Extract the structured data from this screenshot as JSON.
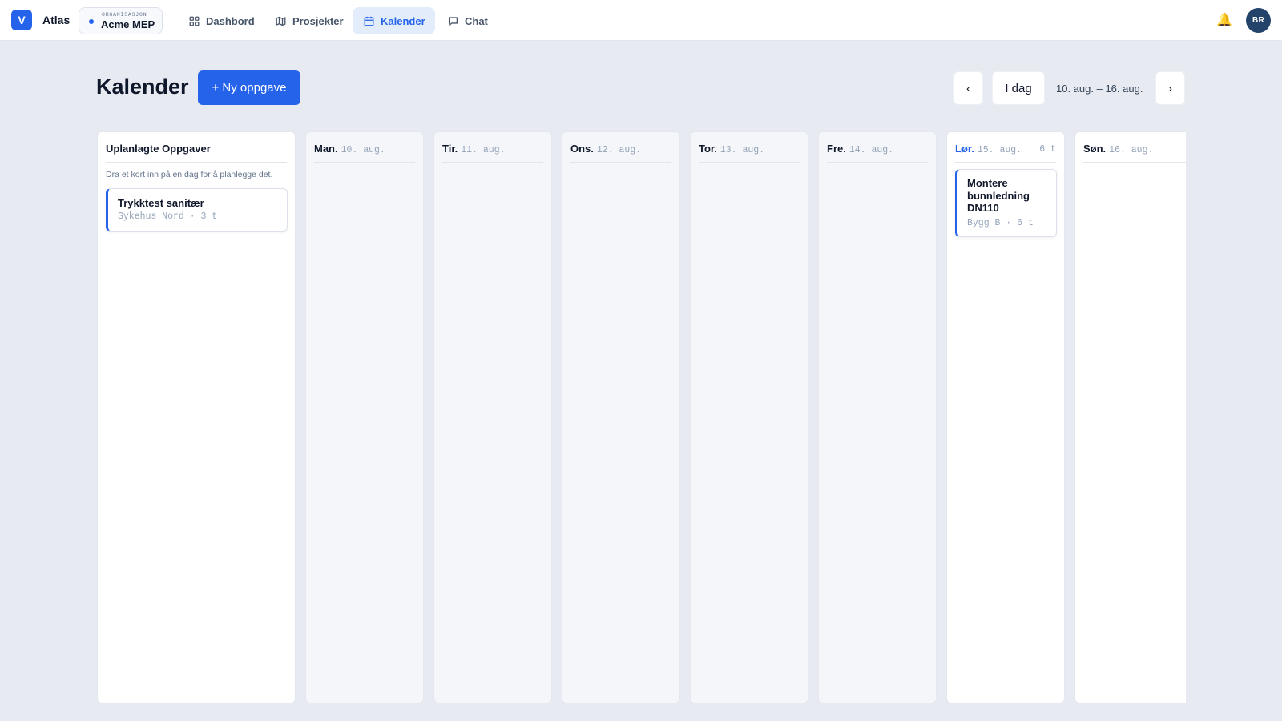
{
  "app": {
    "logo_letter": "V",
    "name": "Atlas"
  },
  "org": {
    "caption": "ORGANISASJON",
    "name": "Acme MEP"
  },
  "nav": {
    "items": [
      {
        "label": "Dashbord",
        "icon": "dashboard-icon"
      },
      {
        "label": "Prosjekter",
        "icon": "map-icon"
      },
      {
        "label": "Kalender",
        "icon": "calendar-icon",
        "active": true
      },
      {
        "label": "Chat",
        "icon": "chat-icon"
      }
    ]
  },
  "user": {
    "initials": "BR"
  },
  "page": {
    "title": "Kalender",
    "new_task_label": "+ Ny oppgave",
    "prev_label": "‹",
    "today_label": "I dag",
    "next_label": "›",
    "range": "10. aug. – 16. aug."
  },
  "unplanned": {
    "title": "Uplanlagte Oppgaver",
    "hint": "Dra et kort inn på en dag for å planlegge det.",
    "cards": [
      {
        "title": "Trykktest sanitær",
        "meta": "Sykehus Nord · 3 t"
      }
    ]
  },
  "days": [
    {
      "day": "Man.",
      "date": "10. aug.",
      "hours": ""
    },
    {
      "day": "Tir.",
      "date": "11. aug.",
      "hours": ""
    },
    {
      "day": "Ons.",
      "date": "12. aug.",
      "hours": ""
    },
    {
      "day": "Tor.",
      "date": "13. aug.",
      "hours": ""
    },
    {
      "day": "Fre.",
      "date": "14. aug.",
      "hours": ""
    },
    {
      "day": "Lør.",
      "date": "15. aug.",
      "hours": "6 t",
      "today": true,
      "cards": [
        {
          "title": "Montere bunnledning DN110",
          "meta": "Bygg B · 6 t"
        }
      ]
    },
    {
      "day": "Søn.",
      "date": "16. aug.",
      "hours": ""
    }
  ],
  "colors": {
    "accent": "#2563eb",
    "background": "#e7eaf1"
  }
}
